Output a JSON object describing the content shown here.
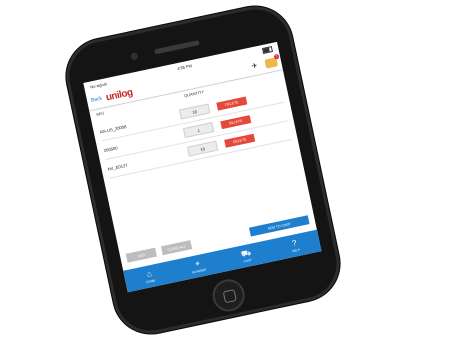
{
  "status": {
    "signal": "No signal",
    "time": "4:55 PM"
  },
  "header": {
    "back_label": "Back",
    "logo_text": "unilog",
    "cart_count": "3"
  },
  "table": {
    "columns": [
      "SKU",
      "QUANTITY"
    ],
    "rows": [
      {
        "part": "AN-US_20008",
        "qty": "10",
        "action": "DELETE"
      },
      {
        "part": "200500",
        "qty": "1",
        "action": "DELETE"
      },
      {
        "part": "NV_E0127",
        "qty": "10",
        "action": "DELETE"
      }
    ]
  },
  "actions": {
    "add": "ADD",
    "clear": "CLEAR ALL",
    "add_to_cart": "ADD TO CART"
  },
  "tabs": [
    {
      "label": "HOME",
      "icon": "home-icon"
    },
    {
      "label": "SCANNER",
      "icon": "scanner-icon"
    },
    {
      "label": "CART",
      "icon": "cart-icon"
    },
    {
      "label": "HELP",
      "icon": "help-icon"
    }
  ]
}
